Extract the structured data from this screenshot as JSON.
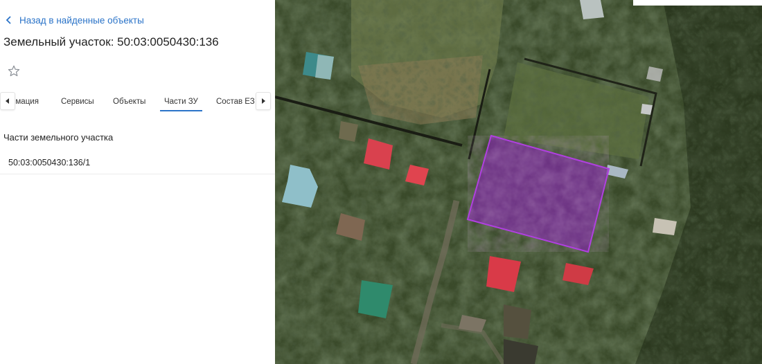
{
  "panel": {
    "back_label": "Назад в найденные объекты",
    "title": "Земельный участок: 50:03:0050430:136",
    "tabs": [
      {
        "label": "рмация"
      },
      {
        "label": "Сервисы"
      },
      {
        "label": "Объекты"
      },
      {
        "label": "Части ЗУ"
      },
      {
        "label": "Состав ЕЗ"
      }
    ],
    "active_tab": "Части ЗУ",
    "section_title": "Части земельного участка",
    "parts": [
      {
        "id": "50:03:0050430:136/1"
      }
    ]
  },
  "icons": {
    "back": "chevron-left-icon",
    "favorite": "star-outline-icon",
    "tab_left": "caret-left-icon",
    "tab_right": "caret-right-icon"
  },
  "colors": {
    "accent": "#2a73c8",
    "parcel_fill": "#7d2ca0",
    "parcel_stroke": "#b040e0"
  }
}
